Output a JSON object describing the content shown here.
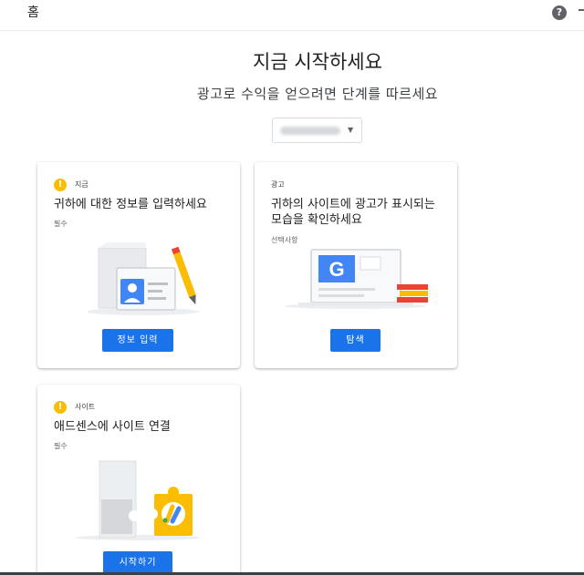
{
  "topbar": {
    "home_label": "홈",
    "help_icon": "help-icon",
    "help_glyph": "?"
  },
  "hero": {
    "title": "지금 시작하세요",
    "subtitle": "광고로 수익을 얻으려면 단계를 따르세요"
  },
  "account_selector": {
    "caret": "▼"
  },
  "cards": [
    {
      "tag": "지금",
      "title": "귀하에 대한 정보를 입력하세요",
      "requirement": "필수",
      "button": "정보 입력",
      "warning": true
    },
    {
      "tag": "광고",
      "title": "귀하의 사이트에 광고가 표시되는 모습을 확인하세요",
      "requirement": "선택사항",
      "button": "탐색",
      "warning": false
    },
    {
      "tag": "사이트",
      "title": "애드센스에 사이트 연결",
      "requirement": "필수",
      "button": "시작하기",
      "warning": true
    }
  ],
  "warning_glyph": "!",
  "colors": {
    "primary_blue": "#1a73e8",
    "warning_yellow": "#fbbc04",
    "google_blue": "#4285f4",
    "red": "#ea4335",
    "text": "#202124"
  }
}
